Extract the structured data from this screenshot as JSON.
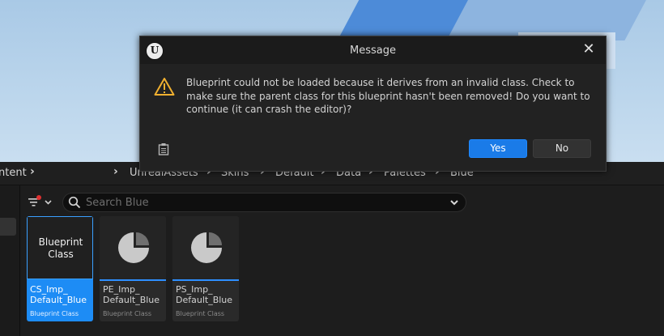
{
  "dialog": {
    "title": "Message",
    "message": "Blueprint could not be loaded because it derives from an invalid class.  Check to make sure the parent class for this blueprint hasn't been removed! Do you want to continue (it can crash the editor)?",
    "yes_label": "Yes",
    "no_label": "No",
    "logo_glyph": "U",
    "close_glyph": "✕",
    "icons": {
      "logo": "unreal-logo-icon",
      "warning": "warning-icon",
      "clipboard": "clipboard-icon",
      "close": "close-icon"
    }
  },
  "content_browser": {
    "path_left": "ntent",
    "breadcrumbs": [
      "UnrealAssets",
      "Skins",
      "Default",
      "Data",
      "Palettes",
      "Blue"
    ],
    "search_placeholder": "Search Blue",
    "assets": [
      {
        "name": "CS_Imp_\nDefault_Blue",
        "type": "Blueprint Class",
        "thumb_label": "Blueprint\nClass",
        "selected": true
      },
      {
        "name": "PE_Imp_\nDefault_Blue",
        "type": "Blueprint Class",
        "thumb_label": "",
        "selected": false
      },
      {
        "name": "PS_Imp_\nDefault_Blue",
        "type": "Blueprint Class",
        "thumb_label": "",
        "selected": false
      }
    ]
  },
  "colors": {
    "accent": "#1a7be8",
    "warning": "#f0b030"
  }
}
